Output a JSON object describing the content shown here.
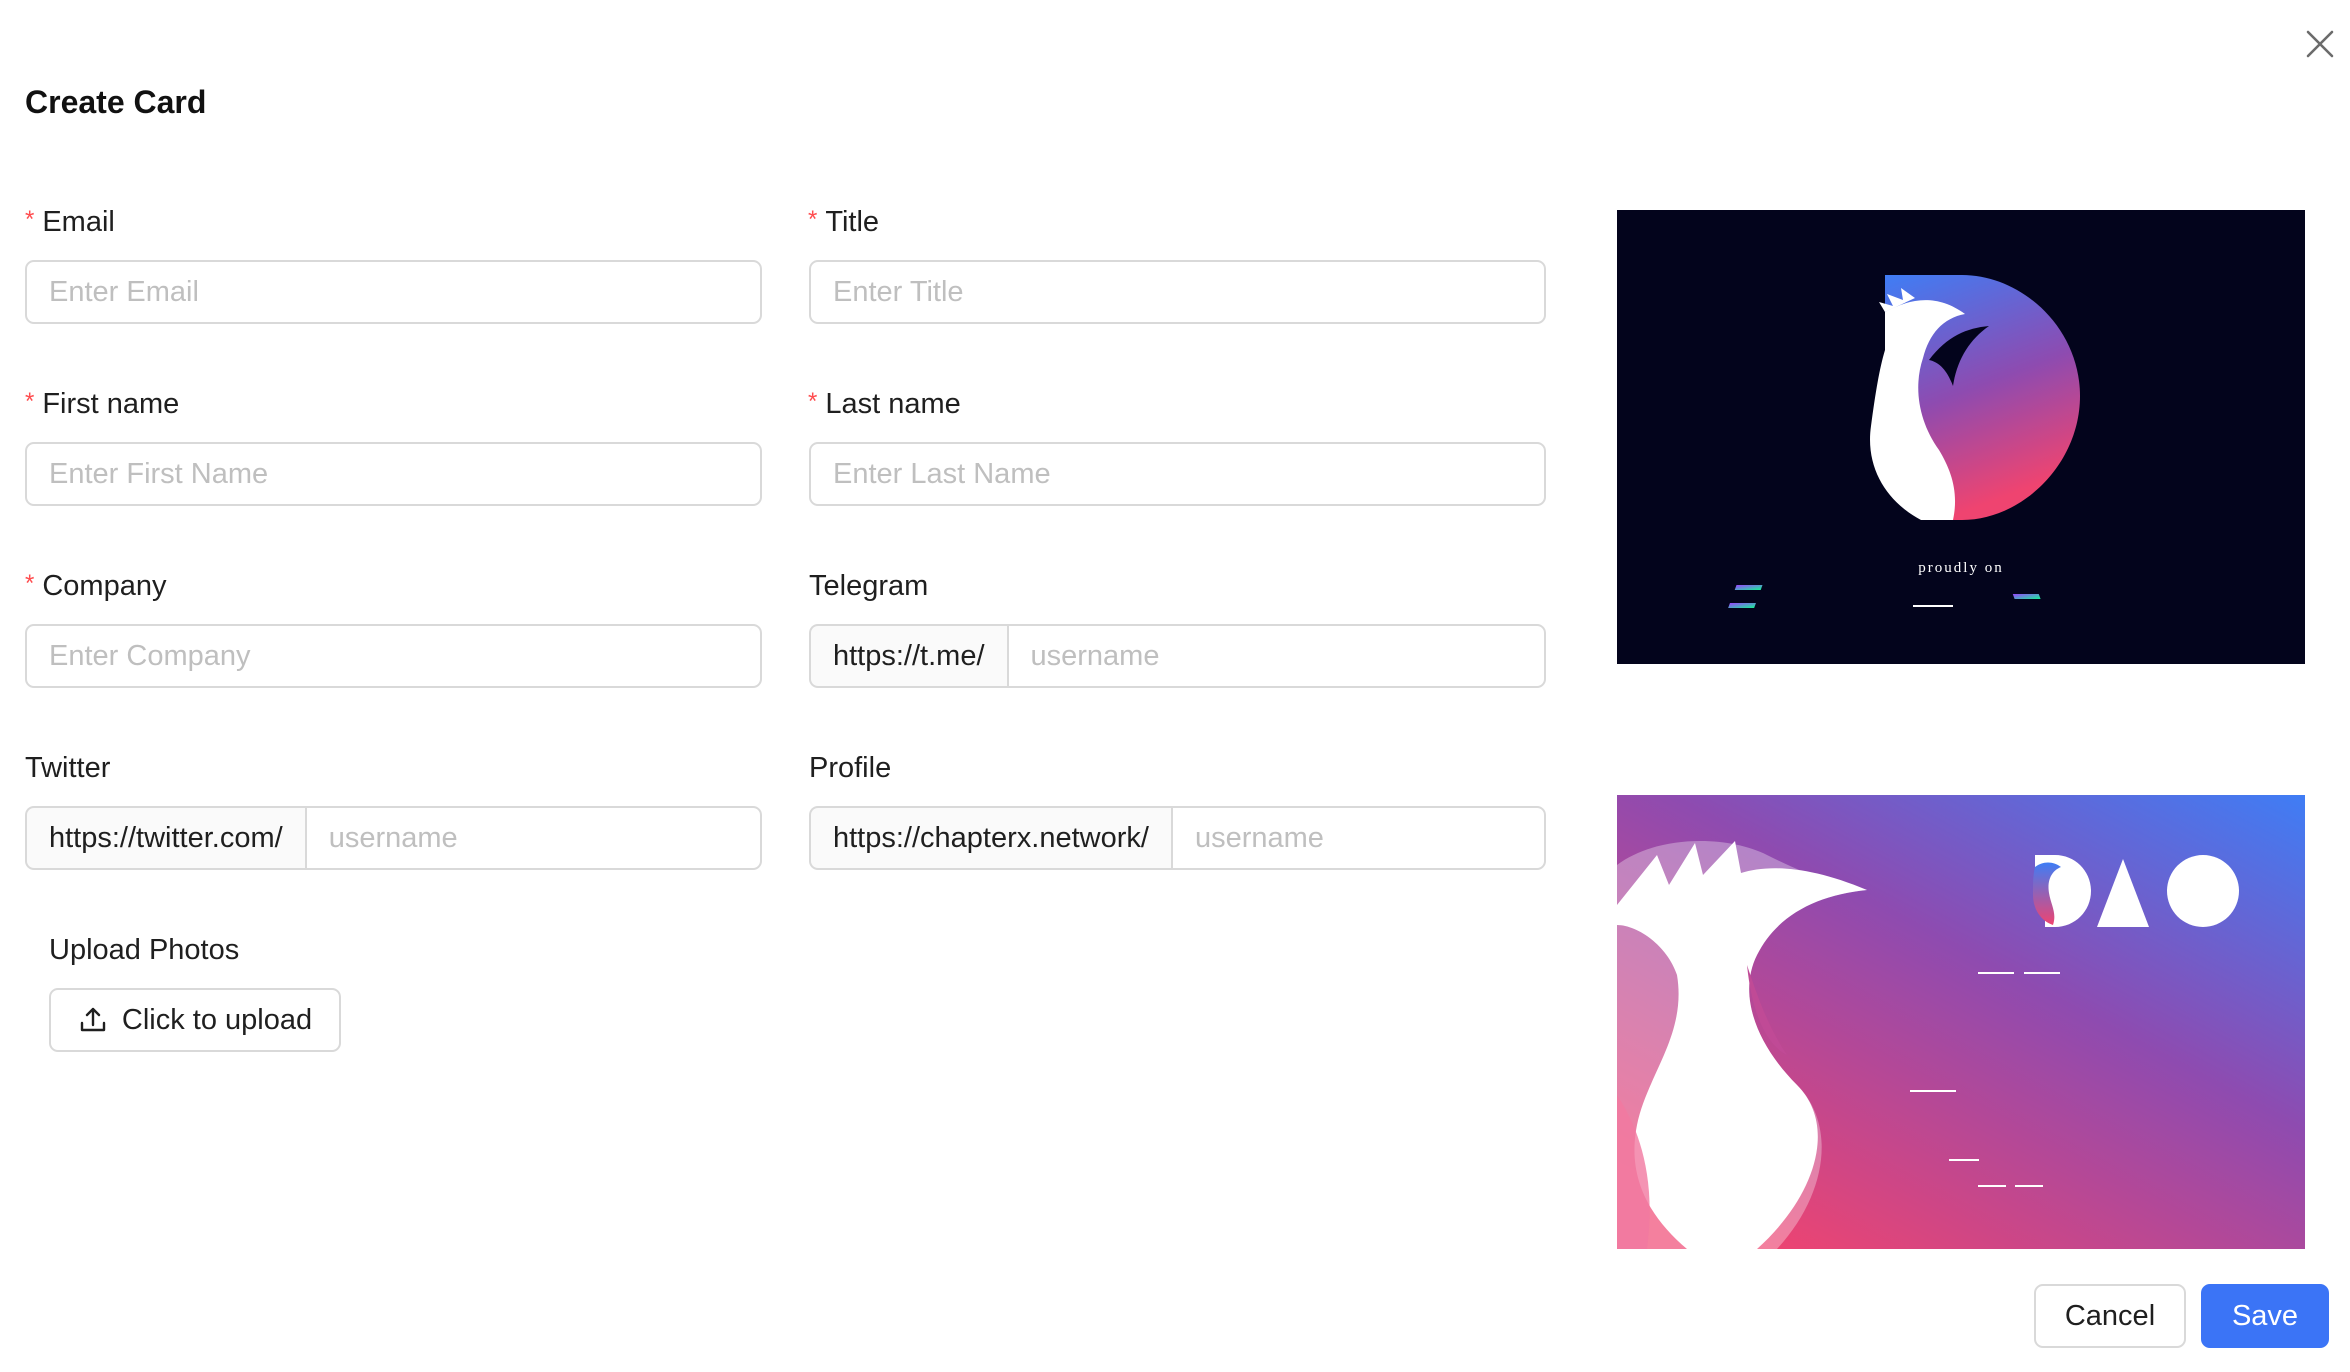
{
  "modal": {
    "title": "Create Card"
  },
  "form": {
    "email": {
      "label": "Email",
      "required": true,
      "placeholder": "Enter Email",
      "value": ""
    },
    "title": {
      "label": "Title",
      "required": true,
      "placeholder": "Enter Title",
      "value": ""
    },
    "first_name": {
      "label": "First name",
      "required": true,
      "placeholder": "Enter First Name",
      "value": ""
    },
    "last_name": {
      "label": "Last name",
      "required": true,
      "placeholder": "Enter Last Name",
      "value": ""
    },
    "company": {
      "label": "Company",
      "required": true,
      "placeholder": "Enter Company",
      "value": ""
    },
    "telegram": {
      "label": "Telegram",
      "required": false,
      "prefix": "https://t.me/",
      "placeholder": "username",
      "value": ""
    },
    "twitter": {
      "label": "Twitter",
      "required": false,
      "prefix": "https://twitter.com/",
      "placeholder": "username",
      "value": ""
    },
    "profile": {
      "label": "Profile",
      "required": false,
      "prefix": "https://chapterx.network/",
      "placeholder": "username",
      "value": ""
    },
    "upload": {
      "label": "Upload Photos",
      "button_label": "Click to upload",
      "icon": "upload-icon"
    }
  },
  "preview": {
    "front_caption": "proudly on"
  },
  "footer": {
    "cancel_label": "Cancel",
    "save_label": "Save"
  },
  "colors": {
    "primary": "#3b74f6",
    "required_mark": "#ff4d4f",
    "card_front_bg": "#03041c",
    "gradient_blue": "#3f7df5",
    "gradient_pink": "#ef4470",
    "gradient_purple": "#8e4bb0"
  }
}
